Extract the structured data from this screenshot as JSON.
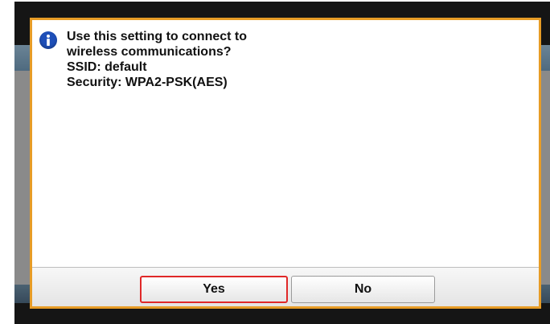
{
  "dialog": {
    "icon": "info-icon",
    "message_lines": [
      "Use this setting to connect to",
      "wireless communications?",
      "SSID: default",
      "Security: WPA2-PSK(AES)"
    ],
    "buttons": {
      "yes_label": "Yes",
      "no_label": "No"
    }
  },
  "colors": {
    "dialog_border": "#e79c26",
    "selected_button_border": "#e02828",
    "info_icon": "#1e4fb8"
  }
}
